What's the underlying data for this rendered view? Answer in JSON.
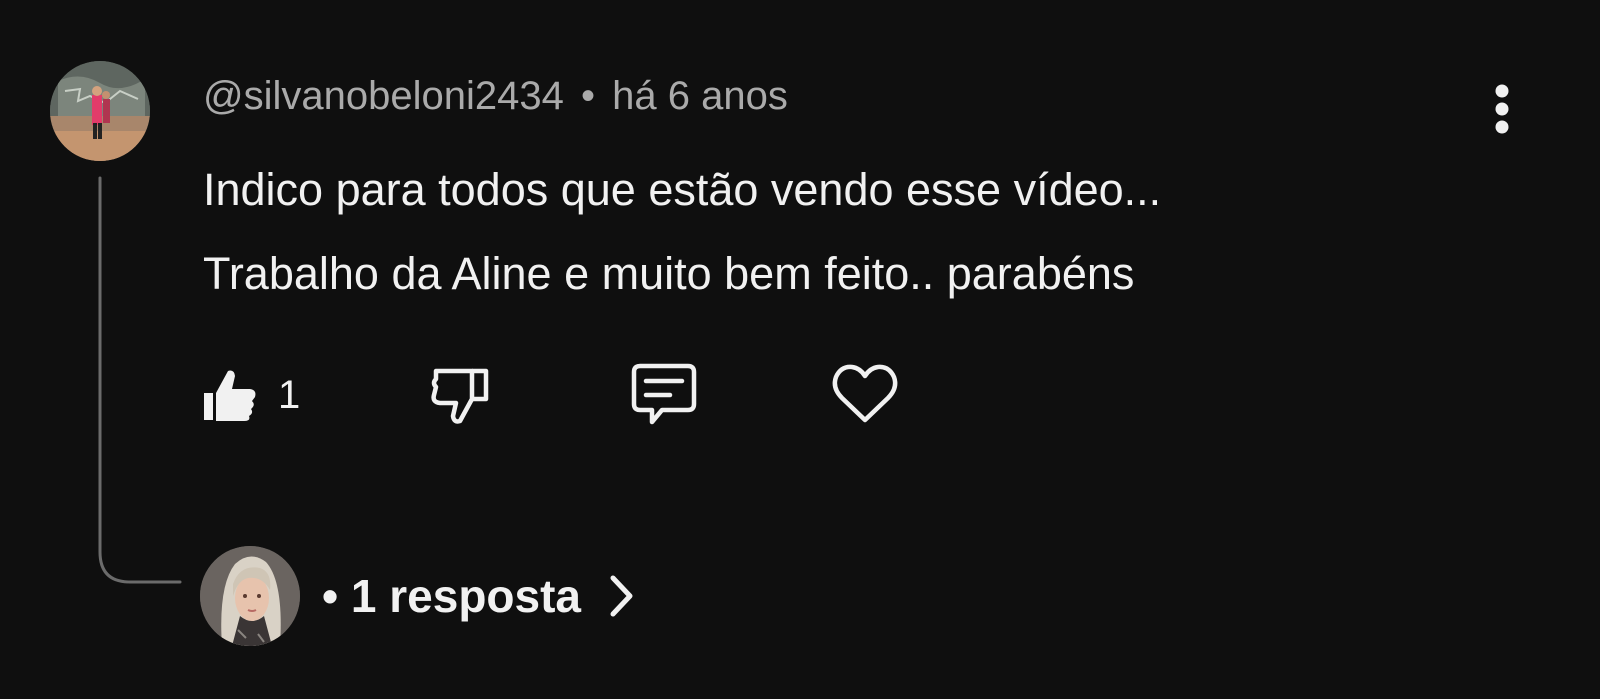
{
  "comment": {
    "author": "@silvanobeloni2434",
    "separator": "•",
    "time": "há 6 anos",
    "text_lines": [
      "Indico para todos que estão vendo esse vídeo...",
      "Trabalho da Aline e muito bem feito.. parabéns"
    ],
    "like_count": "1"
  },
  "replies": {
    "label": "• 1 resposta"
  },
  "icons": {
    "menu": "more-vert-icon",
    "like": "thumbs-up-filled-icon",
    "dislike": "thumbs-down-outline-icon",
    "reply": "comment-reply-icon",
    "heart": "heart-outline-icon",
    "expand": "chevron-right-icon"
  },
  "colors": {
    "background": "#0f0f0f",
    "primary_text": "#f1f1f1",
    "secondary_text": "#aaaaaa",
    "thread_line": "#6b6b6b"
  }
}
